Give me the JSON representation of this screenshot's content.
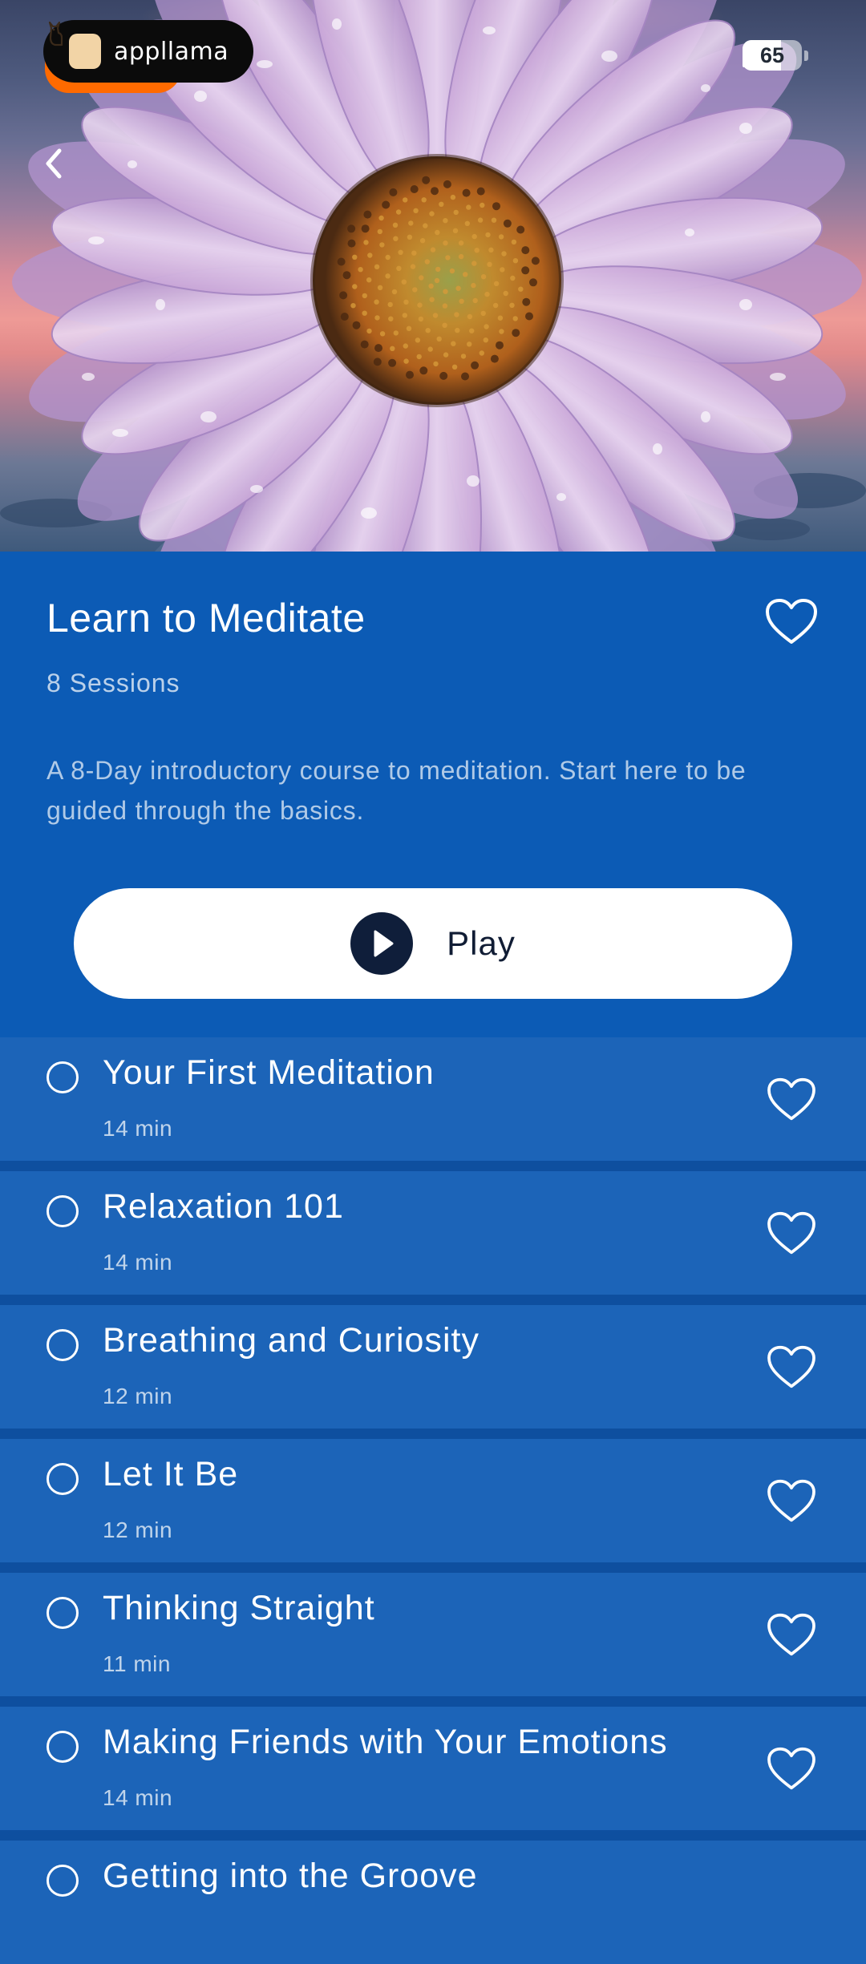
{
  "status_bar": {
    "brand": "appllama",
    "battery": "65",
    "battery_level": 0.65
  },
  "hero": {
    "image": "pink-daisy-flower-with-water-drops",
    "back_icon": "chevron-left-icon"
  },
  "course": {
    "title": "Learn to Meditate",
    "sessions_count": "8 Sessions",
    "description": "A 8-Day introductory course to meditation. Start here to be guided through the basics.",
    "play_label": "Play",
    "favorite_icon": "heart-outline-icon"
  },
  "sessions": [
    {
      "title": "Your First Meditation",
      "duration": "14 min"
    },
    {
      "title": "Relaxation 101",
      "duration": "14 min"
    },
    {
      "title": "Breathing and Curiosity",
      "duration": "12 min"
    },
    {
      "title": "Let It Be",
      "duration": "12 min"
    },
    {
      "title": "Thinking Straight",
      "duration": "11 min"
    },
    {
      "title": "Making Friends with Your Emotions",
      "duration": "14 min"
    },
    {
      "title": "Getting into the Groove",
      "duration": ""
    }
  ],
  "colors": {
    "panel": "#0c5bb5",
    "row": "#1c64b8",
    "divider": "#0e4f9f",
    "play_button": "#ffffff",
    "play_icon": "#0f1e3a",
    "brand_accent": "#ff6a00"
  }
}
